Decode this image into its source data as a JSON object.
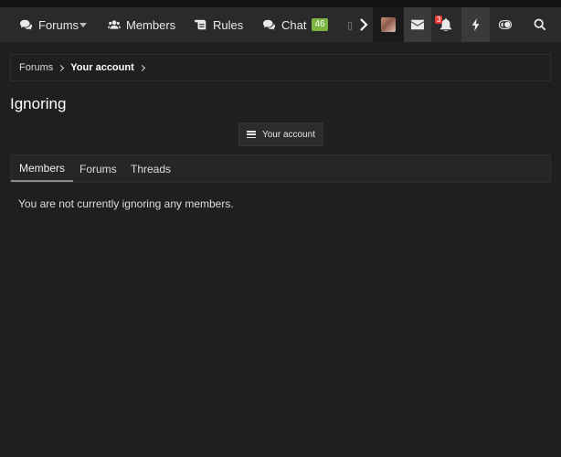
{
  "nav": {
    "items": [
      {
        "label": "Forums",
        "icon": "comments-icon"
      },
      {
        "label": "Members",
        "icon": "users-icon"
      },
      {
        "label": "Rules",
        "icon": "scroll-icon"
      },
      {
        "label": "Chat",
        "icon": "comments-icon",
        "badge": "46"
      }
    ],
    "alerts_count": "3",
    "colors": {
      "chat_badge": "#7cb342",
      "alert_badge": "#e53935"
    }
  },
  "breadcrumb": [
    {
      "label": "Forums"
    },
    {
      "label": "Your account"
    }
  ],
  "page": {
    "title": "Ignoring",
    "account_button": "Your account"
  },
  "tabs": [
    {
      "label": "Members",
      "active": true
    },
    {
      "label": "Forums",
      "active": false
    },
    {
      "label": "Threads",
      "active": false
    }
  ],
  "content": {
    "empty_message": "You are not currently ignoring any members."
  }
}
